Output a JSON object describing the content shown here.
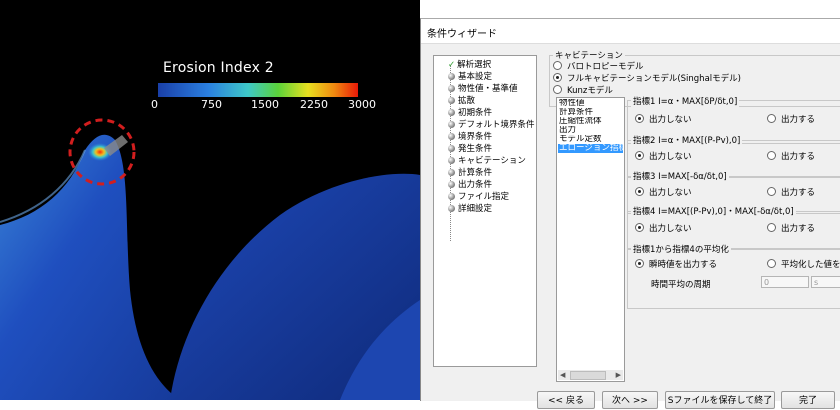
{
  "render": {
    "colorbar_title": "Erosion Index 2",
    "ticks": [
      "0",
      "750",
      "1500",
      "2250",
      "3000"
    ],
    "colors": {
      "background": "#000000",
      "blade": "#1f4fbf",
      "hot": "#ff2a00",
      "annotation": "#d21e1e"
    }
  },
  "dialog": {
    "title": "条件ウィザード",
    "tree": [
      {
        "label": "解析選択",
        "checked": true
      },
      {
        "label": "基本設定"
      },
      {
        "label": "物性値・基準値"
      },
      {
        "label": "拡散"
      },
      {
        "label": "初期条件"
      },
      {
        "label": "デフォルト境界条件"
      },
      {
        "label": "境界条件"
      },
      {
        "label": "発生条件"
      },
      {
        "label": "キャビテーション"
      },
      {
        "label": "計算条件"
      },
      {
        "label": "出力条件"
      },
      {
        "label": "ファイル指定"
      },
      {
        "label": "詳細設定"
      }
    ],
    "cavitation": {
      "group_title": "キャビテーション",
      "options": [
        "バロトロピーモデル",
        "フルキャビテーションモデル(Singhalモデル)",
        "Kunzモデル"
      ],
      "selected_index": 1
    },
    "list_items": [
      "物性値",
      "計算条件",
      "圧縮性流体",
      "出力",
      "モデル定数",
      "エロージョン指標"
    ],
    "selected_list_index": 5,
    "indices": [
      {
        "title": "指標1 I=α・MAX[δP/δt,0]",
        "off": "出力しない",
        "on": "出力する"
      },
      {
        "title": "指標2 I=α・MAX[(P-Pv),0]",
        "off": "出力しない",
        "on": "出力する"
      },
      {
        "title": "指標3 I=MAX[-δα/δt,0]",
        "off": "出力しない",
        "on": "出力する"
      },
      {
        "title": "指標4 I=MAX[(P-Pv),0]・MAX[-δα/δt,0]",
        "off": "出力しない",
        "on": "出力する"
      }
    ],
    "average": {
      "title": "指標1から指標4の平均化",
      "opt1": "瞬時値を出力する",
      "opt2": "平均化した値を出力",
      "period_label": "時間平均の周期",
      "period_value": "0",
      "unit_value": "s"
    },
    "buttons": {
      "back": "<< 戻る",
      "next": "次へ >>",
      "save": "Sファイルを保存して終了",
      "finish": "完了"
    }
  }
}
